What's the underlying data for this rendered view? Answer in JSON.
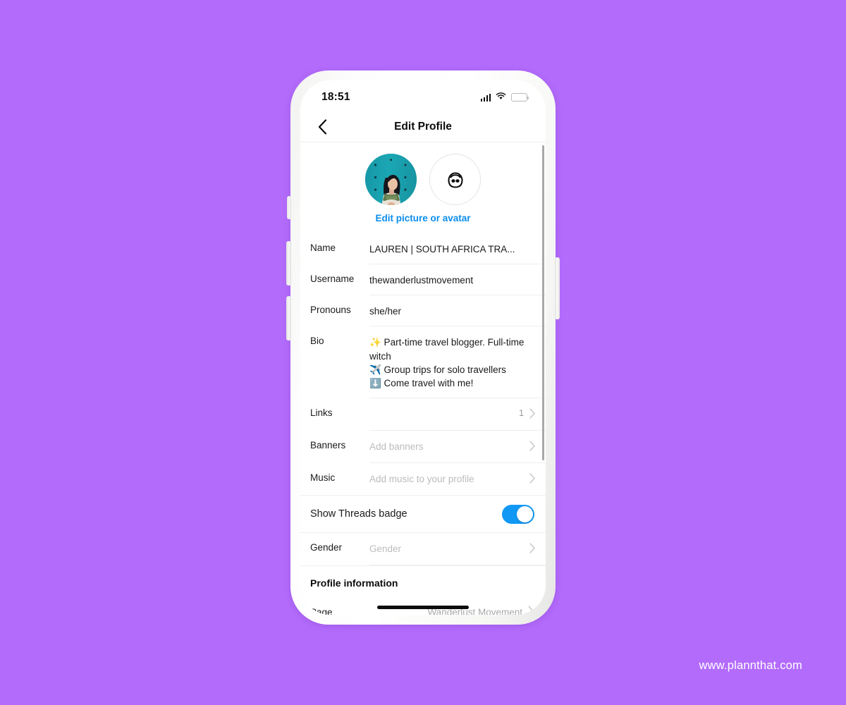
{
  "background_color": "#b36bfc",
  "watermark": "www.plannthat.com",
  "accent_color": "#0a8dec",
  "toggle_on_color": "#1198f5",
  "status_bar": {
    "time": "18:51",
    "signal_icon": "signal-bars-icon",
    "wifi_icon": "wifi-icon",
    "battery_icon": "battery-low-icon",
    "battery_level_percent": 22
  },
  "nav": {
    "back_icon": "chevron-left-icon",
    "title": "Edit Profile"
  },
  "avatar": {
    "profile_photo_alt": "profile-photo",
    "avatar_icon": "avatar-face-icon",
    "edit_link": "Edit picture or avatar"
  },
  "fields": [
    {
      "label": "Name",
      "value": "LAUREN | SOUTH AFRICA TRA...",
      "placeholder": false,
      "chevron": false,
      "count": ""
    },
    {
      "label": "Username",
      "value": "thewanderlustmovement",
      "placeholder": false,
      "chevron": false,
      "count": ""
    },
    {
      "label": "Pronouns",
      "value": "she/her",
      "placeholder": false,
      "chevron": false,
      "count": ""
    },
    {
      "label": "Bio",
      "value": "✨ Part-time travel blogger. Full-time witch\n✈️ Group trips for solo travellers\n⬇️ Come travel with me!",
      "placeholder": false,
      "chevron": false,
      "count": ""
    },
    {
      "label": "Links",
      "value": "",
      "placeholder": false,
      "chevron": true,
      "count": "1"
    },
    {
      "label": "Banners",
      "value": "Add banners",
      "placeholder": true,
      "chevron": true,
      "count": ""
    },
    {
      "label": "Music",
      "value": "Add music to your profile",
      "placeholder": true,
      "chevron": true,
      "count": ""
    }
  ],
  "threads_row": {
    "label": "Show Threads badge",
    "toggle_state": "on"
  },
  "gender_row": {
    "label": "Gender",
    "placeholder": "Gender",
    "chevron_icon": "chevron-right-icon"
  },
  "profile_information": {
    "header": "Profile information",
    "page_label": "Page",
    "page_value": "Wanderlust Movement",
    "chevron_icon": "chevron-right-icon"
  }
}
